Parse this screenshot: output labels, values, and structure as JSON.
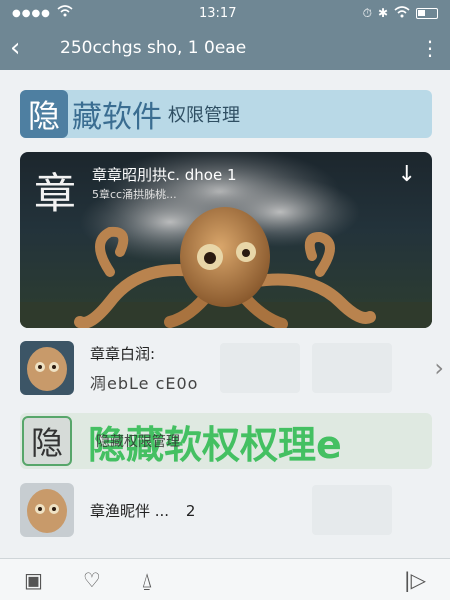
{
  "status_bar": {
    "signal": "●●●●",
    "time": "13:17"
  },
  "app_bar": {
    "back_icon": "chevron-left-icon",
    "title": "250cchgs sho, 1 0eae",
    "more_icon": "more-vertical-icon"
  },
  "banner": {
    "badge": "隐",
    "title": "藏软件",
    "subtitle": "权限管理"
  },
  "card": {
    "badge": "章",
    "title": "章章昭刖拱c. dhoe 1",
    "subtitle": "5章cc涌拱胏桃...",
    "download_icon": "download-arrow-icon"
  },
  "rows": [
    {
      "title": "章章白润:",
      "subtitle": "凋ebLe cE0o"
    },
    {
      "title": "章渔昵伴 ...",
      "count": "2"
    }
  ],
  "green_banner": {
    "badge": "隐",
    "title": "隐藏软权权理e",
    "subtitle": "隐藏权限管理"
  },
  "bottom_tabs": [
    {
      "icon": "calendar-icon",
      "glyph": "▣"
    },
    {
      "icon": "heart-icon",
      "glyph": "♡"
    },
    {
      "icon": "bell-icon",
      "glyph": "⍙"
    },
    {
      "icon": "play-icon",
      "glyph": "|▷"
    }
  ],
  "colors": {
    "header": "#6f8794",
    "banner": "#b9d9e7",
    "accent_green": "#44c062"
  }
}
